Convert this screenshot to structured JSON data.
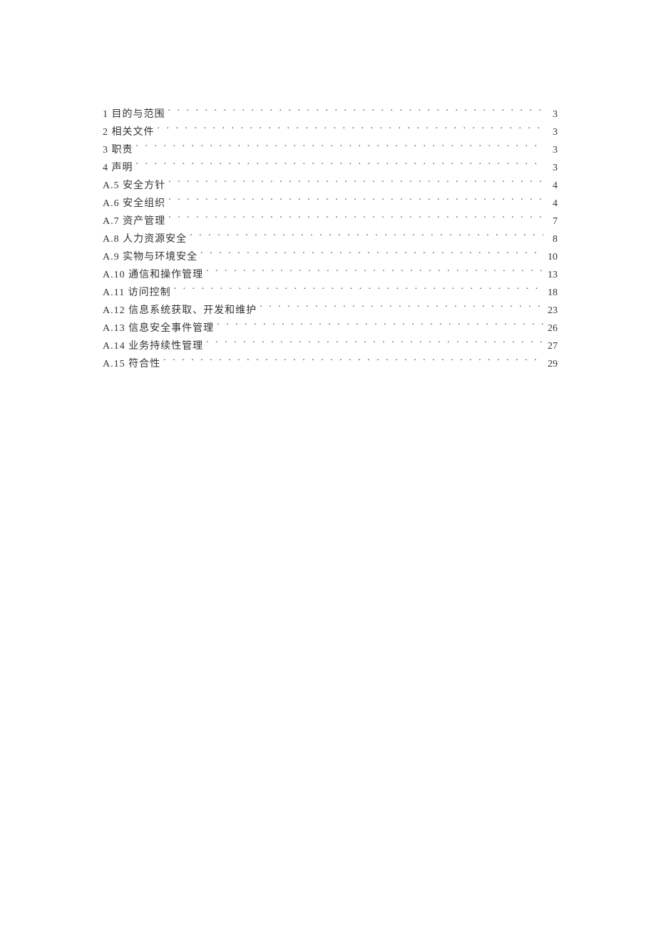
{
  "toc": {
    "entries": [
      {
        "label": "1 目的与范围",
        "page": "3"
      },
      {
        "label": "2 相关文件",
        "page": "3"
      },
      {
        "label": "3 职责",
        "page": "3"
      },
      {
        "label": "4 声明",
        "page": "3"
      },
      {
        "label": "A.5 安全方针",
        "page": "4"
      },
      {
        "label": "A.6 安全组织",
        "page": "4"
      },
      {
        "label": "A.7 资产管理",
        "page": "7"
      },
      {
        "label": "A.8 人力资源安全",
        "page": "8"
      },
      {
        "label": "A.9 实物与环境安全",
        "page": "10"
      },
      {
        "label": "A.10 通信和操作管理",
        "page": "13"
      },
      {
        "label": "A.11 访问控制",
        "page": "18"
      },
      {
        "label": "A.12 信息系统获取、开发和维护",
        "page": "23"
      },
      {
        "label": "A.13 信息安全事件管理",
        "page": "26"
      },
      {
        "label": "A.14 业务持续性管理",
        "page": "27"
      },
      {
        "label": "A.15 符合性",
        "page": "29"
      }
    ]
  }
}
